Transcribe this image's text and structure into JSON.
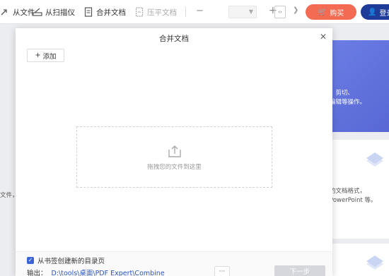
{
  "toolbar": {
    "from_file": "从文件",
    "from_scanner": "从扫描仪",
    "merge_docs": "合并文档",
    "flatten_docs": "压平文档",
    "zoom_minus": "−",
    "zoom_plus": "+",
    "buy_label": "购买",
    "login_label": "登录"
  },
  "background": {
    "banner_line1": "、剪切、",
    "banner_line2": "编辑等操作。",
    "card_line1": "的文档格式，",
    "card_line2": "PowerPoint 等。",
    "left_text": "文件，"
  },
  "dialog": {
    "title": "合并文档",
    "add_label": "添加",
    "drop_text": "拖拽您的文件到这里",
    "bookmark_option": "从书签创建新的目录页",
    "output_label": "输出：",
    "output_path": "D:\\tools\\桌面\\PDF Expert\\Combine",
    "more_label": "···",
    "next_label": "下一步"
  },
  "colors": {
    "accent": "#3b63d6",
    "buy": "#f36b52",
    "login": "#1f3b9a",
    "banner": "#6c7ee6"
  }
}
